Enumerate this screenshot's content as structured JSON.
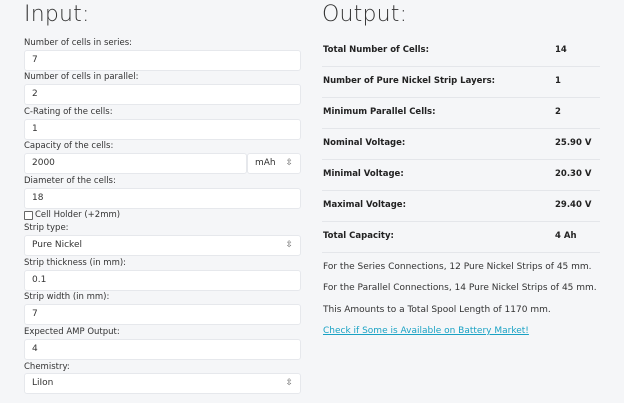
{
  "input": {
    "heading": "Input:",
    "cells_series": {
      "label": "Number of cells in series:",
      "value": "7"
    },
    "cells_parallel": {
      "label": "Number of cells in parallel:",
      "value": "2"
    },
    "c_rating": {
      "label": "C-Rating of the cells:",
      "value": "1"
    },
    "capacity": {
      "label": "Capacity of the cells:",
      "value": "2000",
      "unit": "mAh"
    },
    "diameter": {
      "label": "Diameter of the cells:",
      "value": "18"
    },
    "cell_holder": {
      "label": "Cell Holder (+2mm)",
      "checked": false
    },
    "strip_type": {
      "label": "Strip type:",
      "value": "Pure Nickel"
    },
    "strip_thickness": {
      "label": "Strip thickness (in mm):",
      "value": "0.1"
    },
    "strip_width": {
      "label": "Strip width (in mm):",
      "value": "7"
    },
    "amp_output": {
      "label": "Expected AMP Output:",
      "value": "4"
    },
    "chemistry": {
      "label": "Chemistry:",
      "value": "LiIon"
    },
    "select_arrow": "⇳"
  },
  "output": {
    "heading": "Output:",
    "rows": [
      {
        "label": "Total Number of Cells:",
        "value": "14"
      },
      {
        "label": "Number of Pure Nickel Strip Layers:",
        "value": "1"
      },
      {
        "label": "Minimum Parallel Cells:",
        "value": "2"
      },
      {
        "label": "Nominal Voltage:",
        "value": "25.90 V"
      },
      {
        "label": "Minimal Voltage:",
        "value": "20.30 V"
      },
      {
        "label": "Maximal Voltage:",
        "value": "29.40 V"
      },
      {
        "label": "Total Capacity:",
        "value": "4 Ah"
      }
    ],
    "summary": [
      "For the Series Connections, 12 Pure Nickel Strips of 45 mm.",
      "For the Parallel Connections, 14 Pure Nickel Strips of 45 mm.",
      "This Amounts to a Total Spool Length of 1170 mm."
    ],
    "link": "Check if Some is Available on Battery Market!"
  },
  "colors": {
    "background": "#f5f6f8",
    "link": "#1aa2c4"
  }
}
